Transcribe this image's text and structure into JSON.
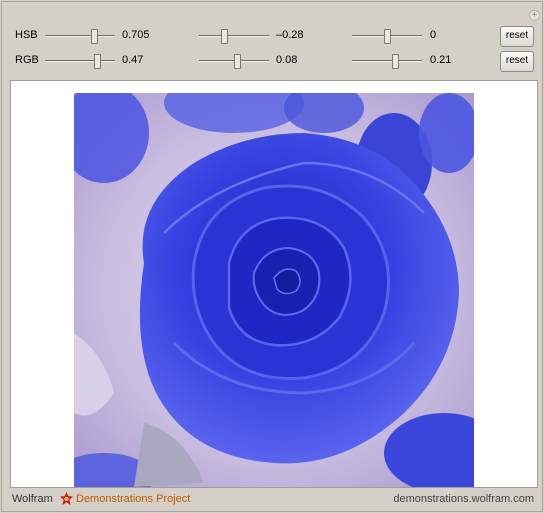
{
  "controls": {
    "rows": [
      {
        "label": "HSB",
        "sliders": [
          {
            "value": "0.705",
            "level": 0.7
          },
          {
            "value": "–0.28",
            "level": 0.36
          },
          {
            "value": "0",
            "level": 0.5
          }
        ],
        "reset_label": "reset"
      },
      {
        "label": "RGB",
        "sliders": [
          {
            "value": "0.47",
            "level": 0.74
          },
          {
            "value": "0.08",
            "level": 0.54
          },
          {
            "value": "0.21",
            "level": 0.61
          }
        ],
        "reset_label": "reset"
      }
    ]
  },
  "display": {
    "colors": {
      "rose_dark": "#1f28c8",
      "rose_mid": "#3c48e8",
      "rose_light": "#6a72f0",
      "background_tint": "#c8b8de"
    }
  },
  "footer": {
    "brand": "Wolfram",
    "project": "Demonstrations Project",
    "url": "demonstrations.wolfram.com"
  }
}
